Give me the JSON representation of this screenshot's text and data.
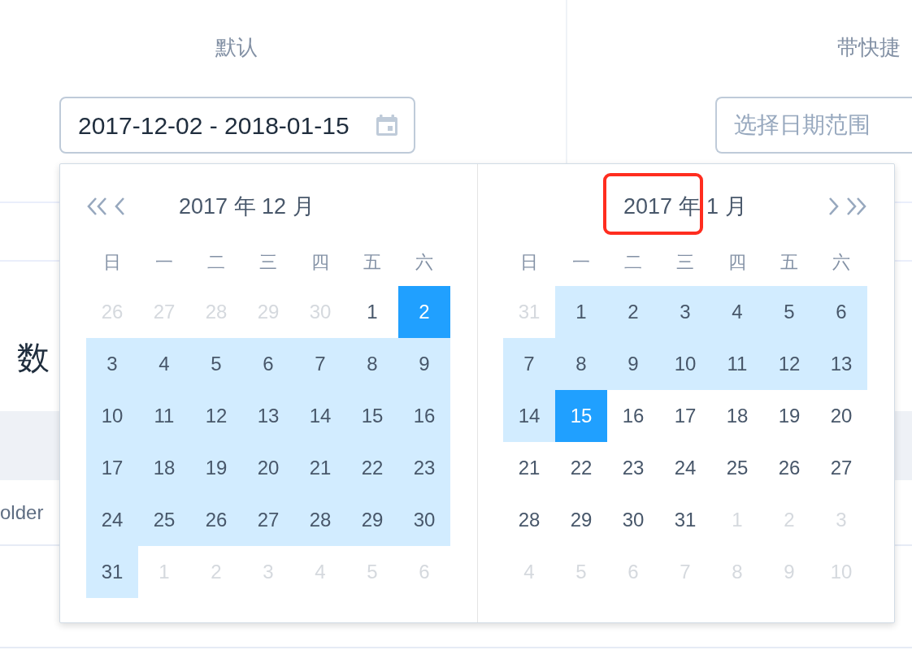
{
  "demos": [
    {
      "label": "默认",
      "input": {
        "value": "2017-12-02 - 2018-01-15"
      }
    },
    {
      "label": "带快捷",
      "input": {
        "placeholder": "选择日期范围"
      }
    }
  ],
  "section_heading": "数",
  "table": {
    "rows": [
      {
        "column_1": "older"
      }
    ]
  },
  "date_picker": {
    "panels": [
      {
        "nav": [
          {
            "kind": "prev_year"
          },
          {
            "kind": "prev_month"
          }
        ],
        "title": "2017 年 12 月",
        "weekdays": [
          "日",
          "一",
          "二",
          "三",
          "四",
          "五",
          "六"
        ],
        "days": [
          {
            "text": "26",
            "other_month": true,
            "in_range": false,
            "selected": false
          },
          {
            "text": "27",
            "other_month": true,
            "in_range": false,
            "selected": false
          },
          {
            "text": "28",
            "other_month": true,
            "in_range": false,
            "selected": false
          },
          {
            "text": "29",
            "other_month": true,
            "in_range": false,
            "selected": false
          },
          {
            "text": "30",
            "other_month": true,
            "in_range": false,
            "selected": false
          },
          {
            "text": "1",
            "other_month": false,
            "in_range": false,
            "selected": false
          },
          {
            "text": "2",
            "other_month": false,
            "in_range": false,
            "selected": true
          },
          {
            "text": "3",
            "other_month": false,
            "in_range": true,
            "selected": false
          },
          {
            "text": "4",
            "other_month": false,
            "in_range": true,
            "selected": false
          },
          {
            "text": "5",
            "other_month": false,
            "in_range": true,
            "selected": false
          },
          {
            "text": "6",
            "other_month": false,
            "in_range": true,
            "selected": false
          },
          {
            "text": "7",
            "other_month": false,
            "in_range": true,
            "selected": false
          },
          {
            "text": "8",
            "other_month": false,
            "in_range": true,
            "selected": false
          },
          {
            "text": "9",
            "other_month": false,
            "in_range": true,
            "selected": false
          },
          {
            "text": "10",
            "other_month": false,
            "in_range": true,
            "selected": false
          },
          {
            "text": "11",
            "other_month": false,
            "in_range": true,
            "selected": false
          },
          {
            "text": "12",
            "other_month": false,
            "in_range": true,
            "selected": false
          },
          {
            "text": "13",
            "other_month": false,
            "in_range": true,
            "selected": false
          },
          {
            "text": "14",
            "other_month": false,
            "in_range": true,
            "selected": false
          },
          {
            "text": "15",
            "other_month": false,
            "in_range": true,
            "selected": false
          },
          {
            "text": "16",
            "other_month": false,
            "in_range": true,
            "selected": false
          },
          {
            "text": "17",
            "other_month": false,
            "in_range": true,
            "selected": false
          },
          {
            "text": "18",
            "other_month": false,
            "in_range": true,
            "selected": false
          },
          {
            "text": "19",
            "other_month": false,
            "in_range": true,
            "selected": false
          },
          {
            "text": "20",
            "other_month": false,
            "in_range": true,
            "selected": false
          },
          {
            "text": "21",
            "other_month": false,
            "in_range": true,
            "selected": false
          },
          {
            "text": "22",
            "other_month": false,
            "in_range": true,
            "selected": false
          },
          {
            "text": "23",
            "other_month": false,
            "in_range": true,
            "selected": false
          },
          {
            "text": "24",
            "other_month": false,
            "in_range": true,
            "selected": false
          },
          {
            "text": "25",
            "other_month": false,
            "in_range": true,
            "selected": false
          },
          {
            "text": "26",
            "other_month": false,
            "in_range": true,
            "selected": false
          },
          {
            "text": "27",
            "other_month": false,
            "in_range": true,
            "selected": false
          },
          {
            "text": "28",
            "other_month": false,
            "in_range": true,
            "selected": false
          },
          {
            "text": "29",
            "other_month": false,
            "in_range": true,
            "selected": false
          },
          {
            "text": "30",
            "other_month": false,
            "in_range": true,
            "selected": false
          },
          {
            "text": "31",
            "other_month": false,
            "in_range": true,
            "selected": false
          },
          {
            "text": "1",
            "other_month": true,
            "in_range": false,
            "selected": false
          },
          {
            "text": "2",
            "other_month": true,
            "in_range": false,
            "selected": false
          },
          {
            "text": "3",
            "other_month": true,
            "in_range": false,
            "selected": false
          },
          {
            "text": "4",
            "other_month": true,
            "in_range": false,
            "selected": false
          },
          {
            "text": "5",
            "other_month": true,
            "in_range": false,
            "selected": false
          },
          {
            "text": "6",
            "other_month": true,
            "in_range": false,
            "selected": false
          }
        ]
      },
      {
        "nav": [
          {
            "kind": "next_month"
          },
          {
            "kind": "next_year"
          }
        ],
        "title": "2017 年 1 月",
        "weekdays": [
          "日",
          "一",
          "二",
          "三",
          "四",
          "五",
          "六"
        ],
        "days": [
          {
            "text": "31",
            "other_month": true,
            "in_range": false,
            "selected": false
          },
          {
            "text": "1",
            "other_month": false,
            "in_range": true,
            "selected": false
          },
          {
            "text": "2",
            "other_month": false,
            "in_range": true,
            "selected": false
          },
          {
            "text": "3",
            "other_month": false,
            "in_range": true,
            "selected": false
          },
          {
            "text": "4",
            "other_month": false,
            "in_range": true,
            "selected": false
          },
          {
            "text": "5",
            "other_month": false,
            "in_range": true,
            "selected": false
          },
          {
            "text": "6",
            "other_month": false,
            "in_range": true,
            "selected": false
          },
          {
            "text": "7",
            "other_month": false,
            "in_range": true,
            "selected": false
          },
          {
            "text": "8",
            "other_month": false,
            "in_range": true,
            "selected": false
          },
          {
            "text": "9",
            "other_month": false,
            "in_range": true,
            "selected": false
          },
          {
            "text": "10",
            "other_month": false,
            "in_range": true,
            "selected": false
          },
          {
            "text": "11",
            "other_month": false,
            "in_range": true,
            "selected": false
          },
          {
            "text": "12",
            "other_month": false,
            "in_range": true,
            "selected": false
          },
          {
            "text": "13",
            "other_month": false,
            "in_range": true,
            "selected": false
          },
          {
            "text": "14",
            "other_month": false,
            "in_range": true,
            "selected": false
          },
          {
            "text": "15",
            "other_month": false,
            "in_range": false,
            "selected": true
          },
          {
            "text": "16",
            "other_month": false,
            "in_range": false,
            "selected": false
          },
          {
            "text": "17",
            "other_month": false,
            "in_range": false,
            "selected": false
          },
          {
            "text": "18",
            "other_month": false,
            "in_range": false,
            "selected": false
          },
          {
            "text": "19",
            "other_month": false,
            "in_range": false,
            "selected": false
          },
          {
            "text": "20",
            "other_month": false,
            "in_range": false,
            "selected": false
          },
          {
            "text": "21",
            "other_month": false,
            "in_range": false,
            "selected": false
          },
          {
            "text": "22",
            "other_month": false,
            "in_range": false,
            "selected": false
          },
          {
            "text": "23",
            "other_month": false,
            "in_range": false,
            "selected": false
          },
          {
            "text": "24",
            "other_month": false,
            "in_range": false,
            "selected": false
          },
          {
            "text": "25",
            "other_month": false,
            "in_range": false,
            "selected": false
          },
          {
            "text": "26",
            "other_month": false,
            "in_range": false,
            "selected": false
          },
          {
            "text": "27",
            "other_month": false,
            "in_range": false,
            "selected": false
          },
          {
            "text": "28",
            "other_month": false,
            "in_range": false,
            "selected": false
          },
          {
            "text": "29",
            "other_month": false,
            "in_range": false,
            "selected": false
          },
          {
            "text": "30",
            "other_month": false,
            "in_range": false,
            "selected": false
          },
          {
            "text": "31",
            "other_month": false,
            "in_range": false,
            "selected": false
          },
          {
            "text": "1",
            "other_month": true,
            "in_range": false,
            "selected": false
          },
          {
            "text": "2",
            "other_month": true,
            "in_range": false,
            "selected": false
          },
          {
            "text": "3",
            "other_month": true,
            "in_range": false,
            "selected": false
          },
          {
            "text": "4",
            "other_month": true,
            "in_range": false,
            "selected": false
          },
          {
            "text": "5",
            "other_month": true,
            "in_range": false,
            "selected": false
          },
          {
            "text": "6",
            "other_month": true,
            "in_range": false,
            "selected": false
          },
          {
            "text": "7",
            "other_month": true,
            "in_range": false,
            "selected": false
          },
          {
            "text": "8",
            "other_month": true,
            "in_range": false,
            "selected": false
          },
          {
            "text": "9",
            "other_month": true,
            "in_range": false,
            "selected": false
          },
          {
            "text": "10",
            "other_month": true,
            "in_range": false,
            "selected": false
          }
        ]
      }
    ]
  }
}
